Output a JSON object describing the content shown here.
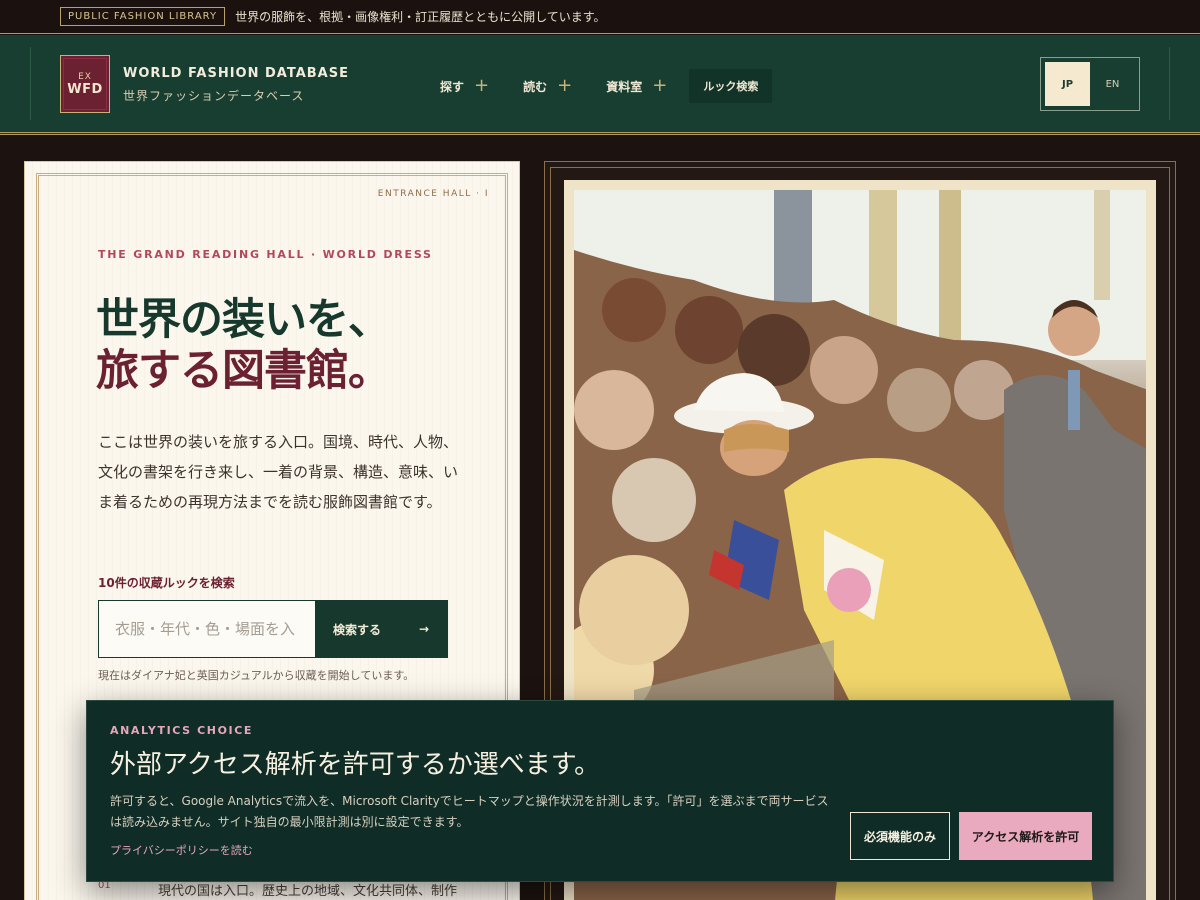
{
  "topbar": {
    "badge": "PUBLIC FASHION LIBRARY",
    "notice": "世界の服飾を、根拠・画像権利・訂正履歴とともに公開しています。"
  },
  "header": {
    "logo_top": "EX",
    "logo_main": "WFD",
    "brand_name": "WORLD FASHION DATABASE",
    "brand_sub": "世界ファッションデータベース",
    "nav": [
      {
        "label": "探す",
        "icon": "plus-icon"
      },
      {
        "label": "読む",
        "icon": "plus-icon"
      },
      {
        "label": "資料室",
        "icon": "plus-icon"
      }
    ],
    "look_search": "ルック検索",
    "lang": {
      "jp": "JP",
      "en": "EN",
      "active": "JP"
    }
  },
  "hero": {
    "entrance": "ENTRANCE HALL · I",
    "eyebrow": "THE GRAND READING HALL · WORLD DRESS",
    "title_line1": "世界の装いを、",
    "title_line2": "旅する図書館。",
    "description": "ここは世界の装いを旅する入口。国境、時代、人物、文化の書架を行き来し、一着の背景、構造、意味、いま着るための再現方法までを読む服飾図書館です。",
    "search_label": "10件の収蔵ルックを検索",
    "search_placeholder": "衣服・年代・色・場面を入",
    "search_button": "検索する",
    "search_button_icon": "arrow-right-icon",
    "search_note": "現在はダイアナ妃と英国カジュアルから収蔵を開始しています。",
    "list_item_num": "01",
    "list_item_text": "現代の国は入口。歴史上の地域、文化共同体、制作"
  },
  "consent": {
    "eyebrow": "ANALYTICS CHOICE",
    "title": "外部アクセス解析を許可するか選べます。",
    "body": "許可すると、Google Analyticsで流入を、Microsoft Clarityでヒートマップと操作状況を計測します。「許可」を選ぶまで両サービスは読み込みません。サイト独自の最小限計測は別に設定できます。",
    "privacy_link": "プライバシーポリシーを読む",
    "btn_essential": "必須機能のみ",
    "btn_allow": "アクセス解析を許可"
  },
  "colors": {
    "header_green": "#173e30",
    "burgundy": "#6b2131",
    "rose_accent": "#e9a9bf",
    "banner_bg": "#0f2c26",
    "gold_rule": "#b09a5e",
    "cream": "#fbf7ee"
  }
}
